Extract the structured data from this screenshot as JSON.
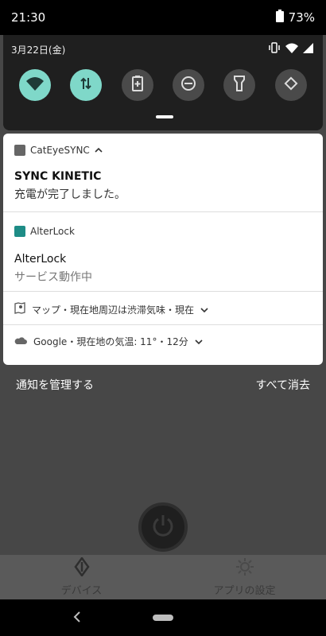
{
  "status_bar": {
    "time": "21:30",
    "battery_percent": "73%"
  },
  "quick_settings": {
    "date": "3月22日(金)",
    "tiles": [
      {
        "name": "wifi",
        "active": true
      },
      {
        "name": "data-transfer",
        "active": true
      },
      {
        "name": "battery-saver",
        "active": false
      },
      {
        "name": "do-not-disturb",
        "active": false
      },
      {
        "name": "flashlight",
        "active": false
      },
      {
        "name": "auto-rotate",
        "active": false
      }
    ]
  },
  "notifications": {
    "cateye": {
      "app_name": "CatEyeSYNC",
      "title": "SYNC KINETIC",
      "text": "充電が完了しました。"
    },
    "alterlock": {
      "app_name": "AlterLock",
      "title": "AlterLock",
      "text": "サービス動作中"
    },
    "maps": {
      "summary": "マップ・現在地周辺は渋滞気味・現在"
    },
    "google": {
      "summary": "Google・現在地の気温: 11°・12分"
    }
  },
  "actions": {
    "manage": "通知を管理する",
    "clear_all": "すべて消去"
  },
  "app_bottom_tabs": [
    {
      "label": "デバイス"
    },
    {
      "label": "アプリの設定"
    }
  ],
  "colors": {
    "accent_teal": "#7fd8c9",
    "alterlock_icon": "#1e8c86"
  }
}
